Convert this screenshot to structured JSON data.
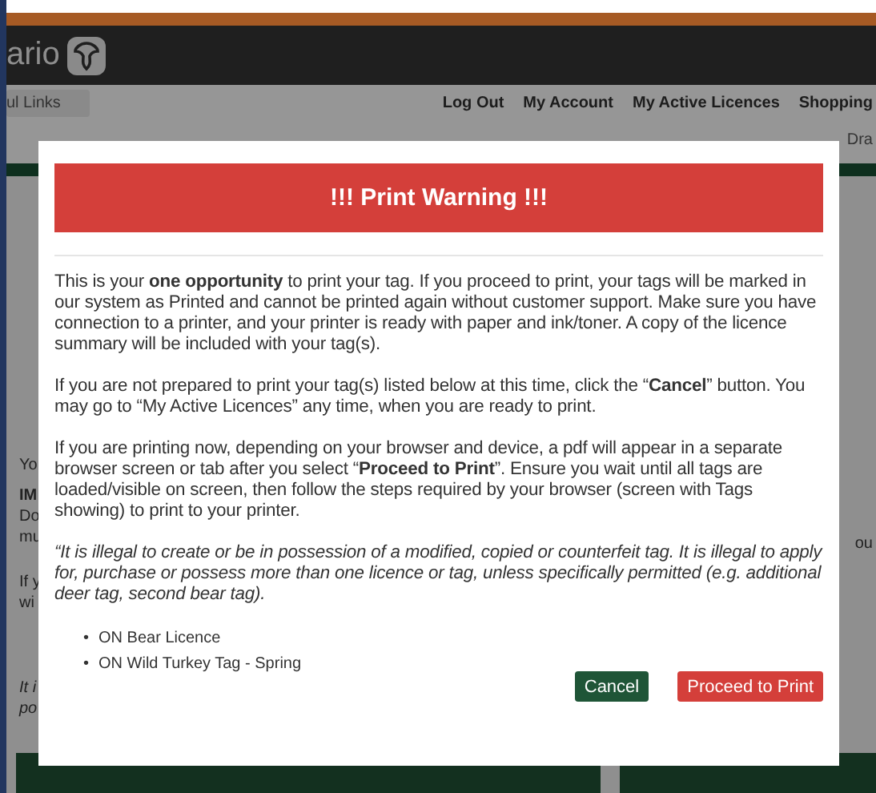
{
  "header": {
    "logo_text": "ario"
  },
  "nav": {
    "quick_links": "ul Links",
    "links": [
      {
        "label": "Log Out"
      },
      {
        "label": "My Account"
      },
      {
        "label": "My Active Licences"
      },
      {
        "label": "Shopping"
      }
    ],
    "sub_links": [
      {
        "label": "Dra"
      }
    ]
  },
  "background_fragments": {
    "left": [
      "Yo",
      "IM",
      "Do",
      "mu",
      "If y",
      "wi"
    ],
    "left_italic": [
      "It i",
      "po"
    ],
    "right": "ou"
  },
  "modal": {
    "title": "!!! Print Warning !!!",
    "paragraphs": [
      {
        "kind": "normal",
        "text": "This is your **one opportunity** to print your tag. If you proceed to print, your tags will be marked in our system as Printed and cannot be printed again without customer support. Make sure you have connection to a printer, and your printer is ready with paper and ink/toner.  A copy of the licence summary will be included with your tag(s)."
      },
      {
        "kind": "normal",
        "text": "If you are not prepared to print your tag(s) listed below at this time, click the “**Cancel**” button. You may go to “My Active Licences” any time, when you are ready to print."
      },
      {
        "kind": "normal",
        "text": "If you are printing now, depending on your browser and device, a pdf will appear in a separate browser screen or tab after you select “**Proceed to Print**”.  Ensure you wait until all tags are loaded/visible on screen, then follow the steps required by your browser (screen with Tags showing) to print to your printer."
      },
      {
        "kind": "italic",
        "text": "“It is illegal to create or be in possession of a modified, copied or counterfeit tag. It is illegal to apply for, purchase or possess more than one licence or tag, unless specifically permitted (e.g. additional deer tag, second bear tag)."
      }
    ],
    "items": [
      {
        "bullet": "•",
        "label": "ON Bear Licence"
      },
      {
        "bullet": "•",
        "label": "ON Wild Turkey Tag - Spring"
      }
    ],
    "buttons": [
      {
        "label": "Cancel",
        "kind": "secondary"
      },
      {
        "label": "Proceed to Print",
        "kind": "primary"
      }
    ]
  }
}
